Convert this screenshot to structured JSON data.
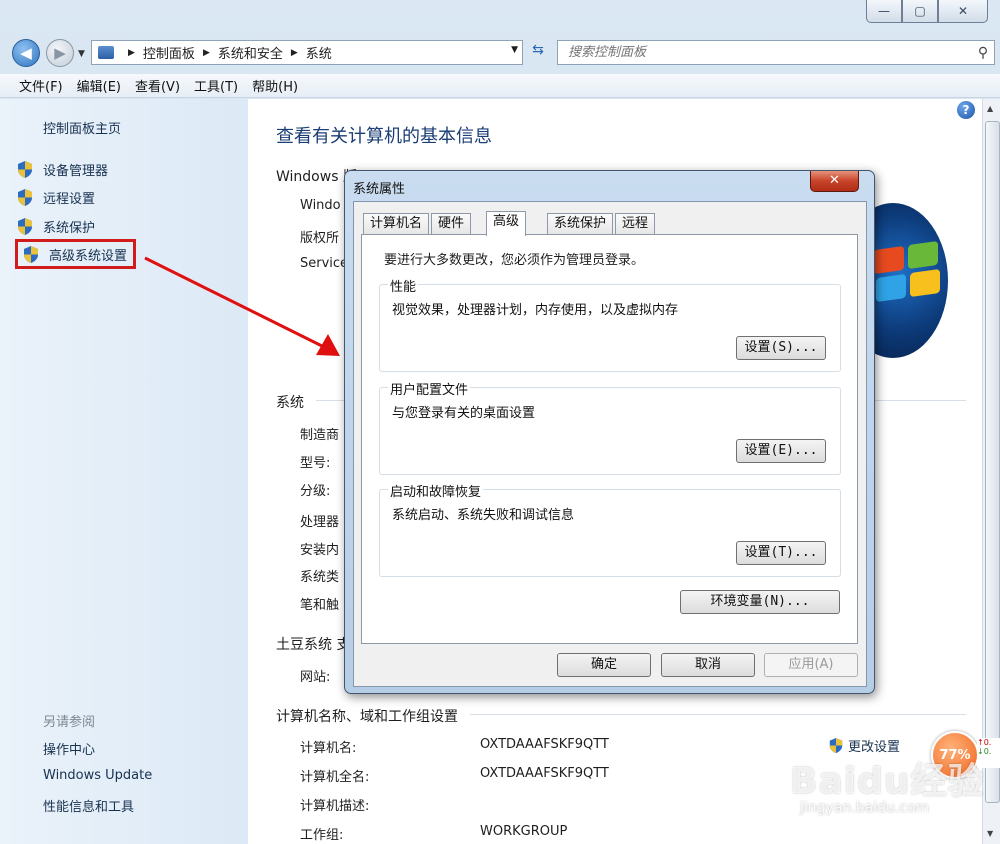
{
  "window": {
    "caption": {
      "minimize_glyph": "—",
      "maximize_glyph": "▢",
      "close_glyph": "✕"
    }
  },
  "address": {
    "crumbs": [
      "控制面板",
      "系统和安全",
      "系统"
    ],
    "search_placeholder": "搜索控制面板"
  },
  "menu": [
    "文件(F)",
    "编辑(E)",
    "查看(V)",
    "工具(T)",
    "帮助(H)"
  ],
  "left": {
    "home": "控制面板主页",
    "tasks": [
      "设备管理器",
      "远程设置",
      "系统保护",
      "高级系统设置"
    ],
    "selected_task": "高级系统设置",
    "see_also": "另请参阅",
    "see_also_links": [
      "操作中心",
      "Windows Update",
      "性能信息和工具"
    ]
  },
  "main": {
    "title": "查看有关计算机的基本信息",
    "windows_edition": "Windows 版",
    "edition_rows": [
      "Windo",
      "版权所",
      "Service"
    ],
    "system_section": "系统",
    "system_rows": [
      "制造商",
      "型号:",
      "分级:",
      "处理器",
      "安装内",
      "系统类",
      "笔和触"
    ],
    "support_section": "土豆系统 支",
    "support_rows": [
      "网站:"
    ],
    "computer_section": "计算机名称、域和工作组设置",
    "computer_rows": [
      {
        "label": "计算机名:",
        "value": "OXTDAAAFSKF9QTT"
      },
      {
        "label": "计算机全名:",
        "value": "OXTDAAAFSKF9QTT"
      },
      {
        "label": "计算机描述:",
        "value": ""
      },
      {
        "label": "工作组:",
        "value": "WORKGROUP"
      }
    ],
    "change_settings": "更改设置"
  },
  "dialog": {
    "title": "系统属性",
    "tabs": [
      "计算机名",
      "硬件",
      "高级",
      "系统保护",
      "远程"
    ],
    "active_tab": "高级",
    "admin_note": "要进行大多数更改，您必须作为管理员登录。",
    "groups": [
      {
        "title": "性能",
        "desc": "视觉效果，处理器计划，内存使用，以及虚拟内存",
        "button": "设置(S)..."
      },
      {
        "title": "用户配置文件",
        "desc": "与您登录有关的桌面设置",
        "button": "设置(E)..."
      },
      {
        "title": "启动和故障恢复",
        "desc": "系统启动、系统失败和调试信息",
        "button": "设置(T)..."
      }
    ],
    "env_button": "环境变量(N)...",
    "ok": "确定",
    "cancel": "取消",
    "apply": "应用(A)"
  },
  "overlay": {
    "badge": "77%",
    "net_up": "0.",
    "net_down": "0.",
    "watermark": "Baidu经验",
    "watermark_url": "jingyan.baidu.com"
  },
  "colors": {
    "highlight_box": "#d21b1b",
    "annotation_arrow": "#e01010",
    "link": "#17314f",
    "title": "#1b3e74"
  }
}
